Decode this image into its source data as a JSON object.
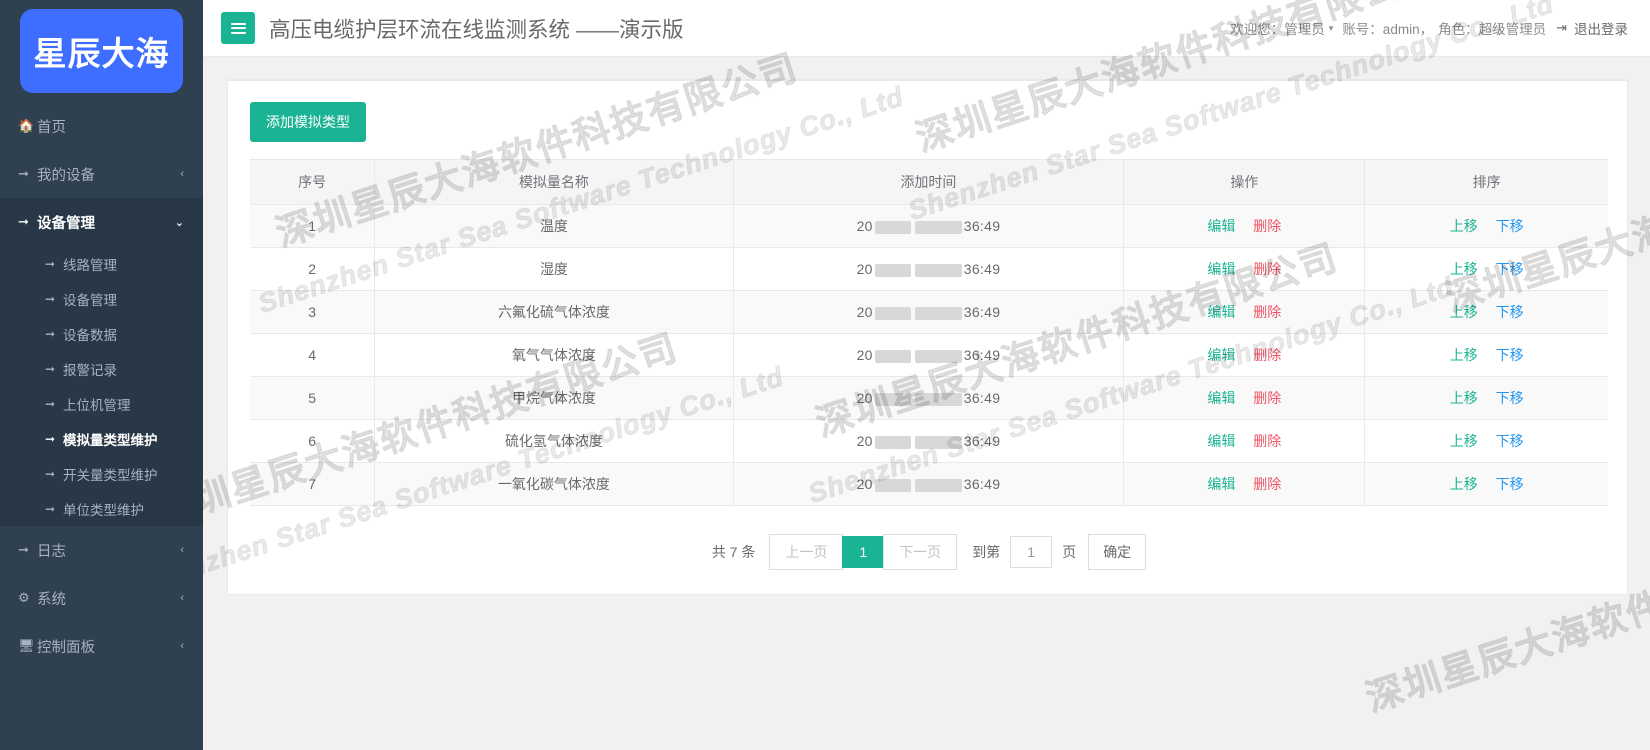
{
  "brand": {
    "logo_text": "星辰大海",
    "logo_bg": "#3d6eff"
  },
  "theme": {
    "sidebar_bg": "#2f4050",
    "sidebar_active_bg": "#293846",
    "accent": "#1ab394",
    "danger": "#ed5565",
    "link_blue": "#2196f3"
  },
  "sidebar": {
    "items": [
      {
        "label": "首页",
        "icon": "home-icon",
        "caret": "",
        "active": false
      },
      {
        "label": "我的设备",
        "icon": "arrow-right-icon",
        "caret": "‹",
        "active": false
      },
      {
        "label": "设备管理",
        "icon": "arrow-right-icon",
        "caret": "⌄",
        "active": true
      },
      {
        "label": "日志",
        "icon": "arrow-right-icon",
        "caret": "‹",
        "active": false
      },
      {
        "label": "系统",
        "icon": "gear-icon",
        "caret": "‹",
        "active": false
      },
      {
        "label": "控制面板",
        "icon": "monitor-icon",
        "caret": "‹",
        "active": false
      }
    ],
    "submenu": [
      {
        "label": "线路管理",
        "active": false
      },
      {
        "label": "设备管理",
        "active": false
      },
      {
        "label": "设备数据",
        "active": false
      },
      {
        "label": "报警记录",
        "active": false
      },
      {
        "label": "上位机管理",
        "active": false
      },
      {
        "label": "模拟量类型维护",
        "active": true
      },
      {
        "label": "开关量类型维护",
        "active": false
      },
      {
        "label": "单位类型维护",
        "active": false
      }
    ]
  },
  "topbar": {
    "menu_toggle_icon": "hamburger-icon",
    "title": "高压电缆护层环流在线监测系统 ——演示版",
    "welcome": "欢迎您：管理员",
    "caret": "▾",
    "account": "账号：admin，",
    "role": "角色：超级管理员",
    "logout_icon": "logout-icon",
    "logout_label": "退出登录"
  },
  "toolbar": {
    "add_label": "添加模拟类型"
  },
  "table": {
    "columns": [
      "序号",
      "模拟量名称",
      "添加时间",
      "操作",
      "排序"
    ],
    "rows": [
      {
        "idx": "1",
        "name": "温度",
        "time_prefix": "20",
        "time_suffix": "36:49"
      },
      {
        "idx": "2",
        "name": "湿度",
        "time_prefix": "20",
        "time_suffix": "36:49"
      },
      {
        "idx": "3",
        "name": "六氟化硫气体浓度",
        "time_prefix": "20",
        "time_suffix": "36:49"
      },
      {
        "idx": "4",
        "name": "氧气气体浓度",
        "time_prefix": "20",
        "time_suffix": "36:49"
      },
      {
        "idx": "5",
        "name": "甲烷气体浓度",
        "time_prefix": "20",
        "time_suffix": "36:49"
      },
      {
        "idx": "6",
        "name": "硫化氢气体浓度",
        "time_prefix": "20",
        "time_suffix": "36:49"
      },
      {
        "idx": "7",
        "name": "一氧化碳气体浓度",
        "time_prefix": "20",
        "time_suffix": "36:49"
      }
    ],
    "ops": {
      "edit": "编辑",
      "delete": "删除"
    },
    "sort": {
      "up": "上移",
      "down": "下移"
    }
  },
  "pagination": {
    "total_text": "共 7 条",
    "prev_label": "上一页",
    "current_page": "1",
    "next_label": "下一页",
    "goto_label": "到第",
    "goto_value": "1",
    "page_unit": "页",
    "confirm_label": "确定"
  },
  "watermark": {
    "cn": "深圳星辰大海软件科技有限公司",
    "en": "Shenzhen Star Sea Software Technology Co., Ltd"
  }
}
